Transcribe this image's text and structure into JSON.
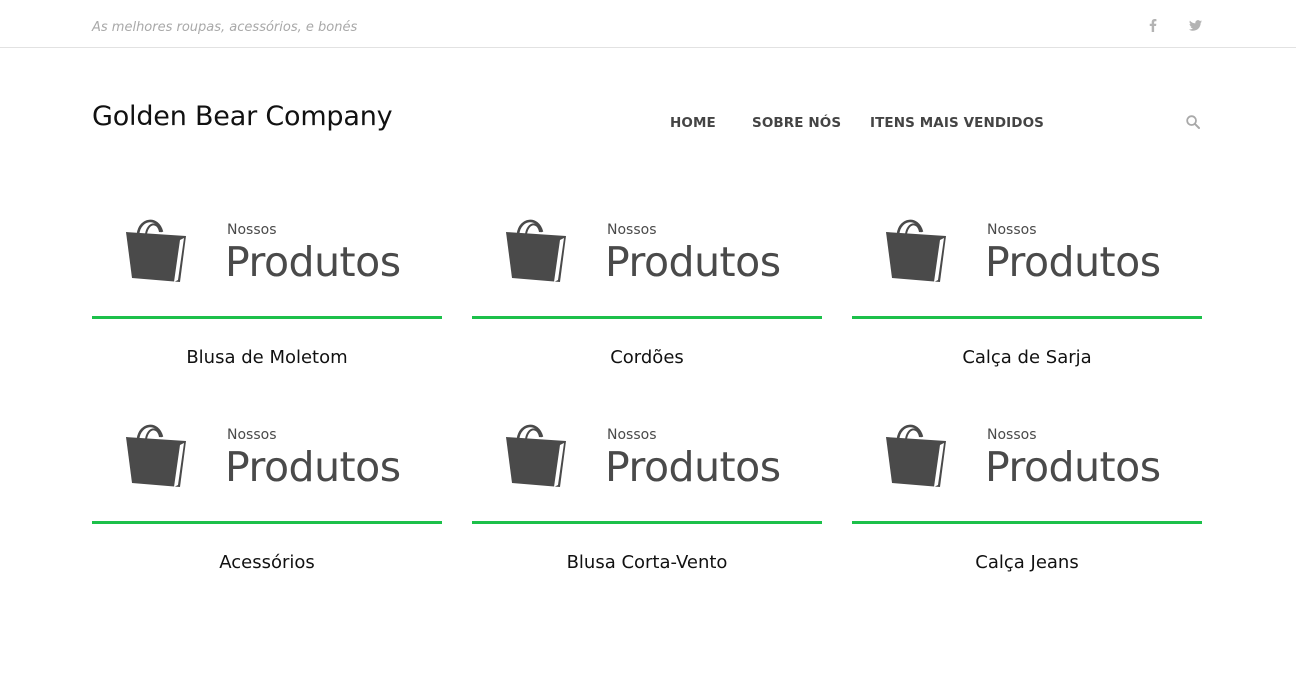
{
  "header": {
    "tagline": "As melhores roupas, acessórios, e bonés",
    "social": {
      "facebook_icon": "facebook-icon",
      "twitter_icon": "twitter-icon"
    }
  },
  "brand": {
    "name": "Golden Bear Company"
  },
  "nav": {
    "items": [
      {
        "label": "HOME"
      },
      {
        "label": "SOBRE NÓS"
      },
      {
        "label": "ITENS MAIS VENDIDOS"
      }
    ],
    "search_icon": "search-icon"
  },
  "banner": {
    "small_text": "Nossos",
    "big_text": "Produtos",
    "accent_color": "#1cc04a",
    "icon": "shopping-bag-icon"
  },
  "products": [
    {
      "name": "Blusa de Moletom"
    },
    {
      "name": "Cordões"
    },
    {
      "name": "Calça de Sarja"
    },
    {
      "name": "Acessórios"
    },
    {
      "name": "Blusa Corta-Vento"
    },
    {
      "name": "Calça Jeans"
    }
  ]
}
